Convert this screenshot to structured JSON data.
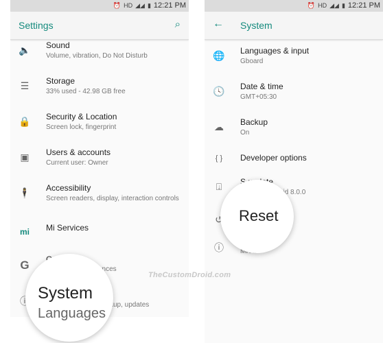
{
  "status": {
    "icons": [
      "alarm-icon",
      "hd-icon",
      "4g-signal-icon",
      "signal-icon",
      "battery-icon"
    ],
    "hd": "HD",
    "time": "12:21 PM"
  },
  "left": {
    "title": "Settings",
    "items": [
      {
        "icon": "volume-icon",
        "title": "Sound",
        "subtitle": "Volume, vibration, Do Not Disturb"
      },
      {
        "icon": "storage-icon",
        "title": "Storage",
        "subtitle": "33% used - 42.98 GB free"
      },
      {
        "icon": "lock-icon",
        "title": "Security & Location",
        "subtitle": "Screen lock, fingerprint"
      },
      {
        "icon": "account-icon",
        "title": "Users & accounts",
        "subtitle": "Current user: Owner"
      },
      {
        "icon": "accessibility-icon",
        "title": "Accessibility",
        "subtitle": "Screen readers, display, interaction controls"
      },
      {
        "icon": "mi-icon",
        "title": "Mi Services",
        "subtitle": ""
      },
      {
        "icon": "google-icon",
        "title": "G",
        "subtitle": "ences"
      },
      {
        "icon": "info-icon",
        "title": "",
        "subtitle": "ckup, updates"
      }
    ],
    "magnifier": {
      "title": "System",
      "subtitle": "Languages"
    }
  },
  "right": {
    "title": "System",
    "items": [
      {
        "icon": "globe-icon",
        "title": "Languages & input",
        "subtitle": "Gboard"
      },
      {
        "icon": "clock-icon",
        "title": "Date & time",
        "subtitle": "GMT+05:30"
      },
      {
        "icon": "cloud-upload-icon",
        "title": "Backup",
        "subtitle": "On"
      },
      {
        "icon": "braces-icon",
        "title": "Developer options",
        "subtitle": ""
      },
      {
        "icon": "system-update-icon",
        "title": "S    update",
        "subtitle": "droid 8.0.0"
      },
      {
        "icon": "restore-icon",
        "title": "",
        "subtitle": ""
      },
      {
        "icon": "info-icon",
        "title": "",
        "subtitle": "MI A1"
      }
    ],
    "magnifier": {
      "title": "Reset"
    }
  },
  "watermark": "TheCustomDroid.com",
  "colors": {
    "accent": "#148a7d"
  }
}
